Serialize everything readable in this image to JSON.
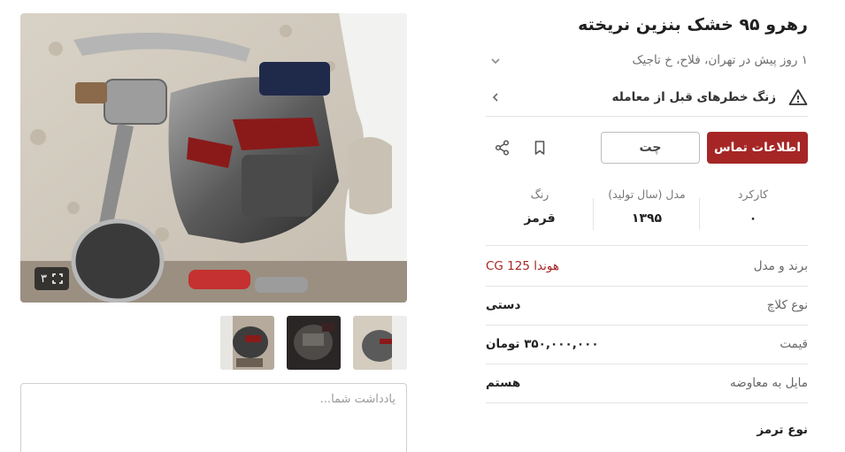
{
  "ad": {
    "title": "رهرو ۹۵ خشک بنزین نریخته",
    "subtitle": "۱ روز پیش در تهران، فلاح، خ تاجیک"
  },
  "warning": {
    "text": "زنگ خطرهای قبل از معامله"
  },
  "actions": {
    "contact_label": "اطلاعات تماس",
    "chat_label": "چت"
  },
  "stats": [
    {
      "label": "کارکرد",
      "value": "۰"
    },
    {
      "label": "مدل (سال تولید)",
      "value": "۱۳۹۵"
    },
    {
      "label": "رنگ",
      "value": "قرمز"
    }
  ],
  "attributes": [
    {
      "key": "برند و مدل",
      "value": "هوندا CG 125"
    },
    {
      "key": "نوع کلاچ",
      "value": "دستی"
    },
    {
      "key": "قیمت",
      "value": "۳۵۰,۰۰۰,۰۰۰ تومان"
    },
    {
      "key": "مایل به معاوضه",
      "value": "هستم"
    }
  ],
  "extra_attribute": {
    "key": "نوع ترمز"
  },
  "gallery": {
    "count": "۳"
  },
  "note": {
    "placeholder": "یادداشت شما..."
  },
  "colors": {
    "accent": "#a62626",
    "border": "#e4e4e4"
  }
}
